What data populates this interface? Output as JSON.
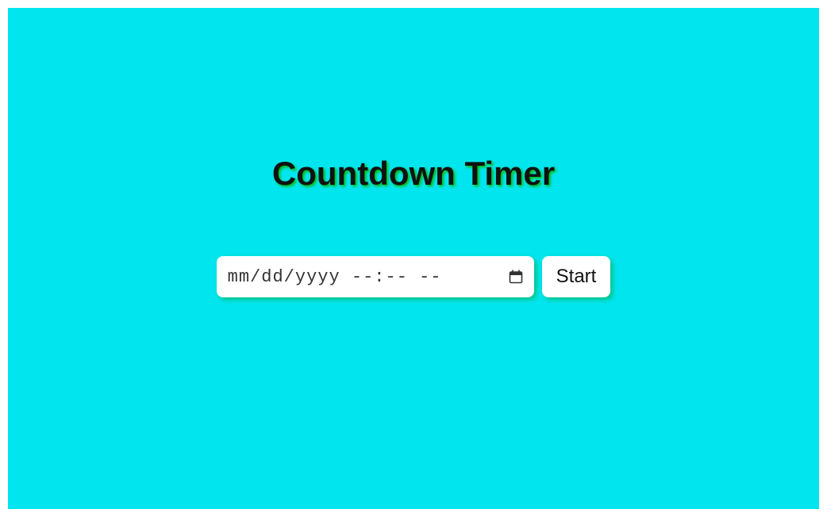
{
  "title": "Countdown Timer",
  "datetime": {
    "placeholder": "mm/dd/yyyy --:-- --",
    "value": ""
  },
  "start_button_label": "Start"
}
